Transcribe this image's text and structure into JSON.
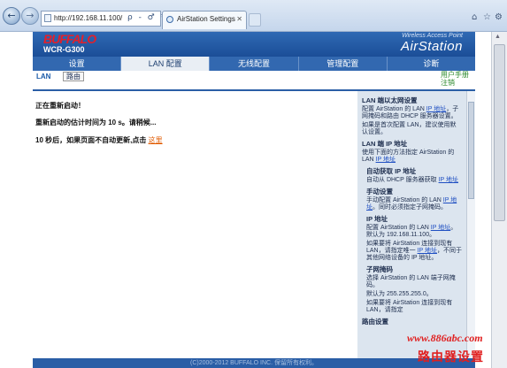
{
  "browser": {
    "url": "http://192.168.11.100/",
    "url_tools": "ρ - ♂ ↻ ✕",
    "tab_title": "AirStation Settings",
    "back_icon": "arrow-left-icon",
    "forward_icon": "arrow-right-icon"
  },
  "header": {
    "brand": "BUFFALO",
    "model": "WCR-G300",
    "tagline": "Wireless Access Point",
    "product": "AirStation"
  },
  "menu": {
    "items": [
      {
        "label": "设置",
        "active": false
      },
      {
        "label": "LAN 配置",
        "active": true
      },
      {
        "label": "无线配置",
        "active": false
      },
      {
        "label": "管理配置",
        "active": false
      },
      {
        "label": "诊断",
        "active": false
      }
    ]
  },
  "subnav": {
    "lan": "LAN",
    "route": "路由",
    "manual": "用户手册",
    "logout": "注销"
  },
  "main": {
    "line1": "正在重新启动！",
    "line2": "重新启动的估计时间为  10 s。请稍候...",
    "line3": "10 秒后，如果页面不自动更新,点击",
    "here_link": "这里"
  },
  "help": {
    "s1_title": "LAN 端以太网设置",
    "s1_p1a": "配置 AirStation 的 LAN",
    "s1_p1_link": "IP 地址",
    "s1_p1b": "，子网掩码和路由 DHCP 服务器设置。",
    "s1_p2": "如果是首次配置 LAN，建议使用默认设置。",
    "s2_title": "LAN 端 IP 地址",
    "s2_p1a": "使用下面的方法指定 AirStation 的 LAN",
    "s2_p1_link": "IP 地址",
    "s3_title": "自动获取 IP 地址",
    "s3_p1a": "自动从 DHCP 服务器获取",
    "s3_p1_link": "IP 地址",
    "s4_title": "手动设置",
    "s4_p1a": "手动配置 AirStation 的 LAN",
    "s4_p1_link": "IP 地址",
    "s4_p1b": "。同时必须指定子网掩码。",
    "s5_title": "IP 地址",
    "s5_p1a": "配置 AirStation 的 LAN",
    "s5_p1_link": "IP 地址",
    "s5_p1b": "。默认为 192.168.11.100。",
    "s5_p2a": "如果要将 AirStation 连接到现有 LAN，请指定唯一",
    "s5_p2_link": "IP 地址",
    "s5_p2b": "，不同于其他网络设备的 IP 地址。",
    "s6_title": "子网掩码",
    "s6_p1": "选择 AirStation 的 LAN 端子网掩码。",
    "s6_p2": "默认为 255.255.255.0。",
    "s6_p3": "如果要将 AirStation 连接到现有 LAN，请指定",
    "s7_title": "路由设置"
  },
  "footer": {
    "copyright": "(C)2000-2012 BUFFALO INC. 保留所有权利。"
  },
  "watermark": {
    "url": "www.886abc.com",
    "text": "路由器设置"
  },
  "colors": {
    "header_blue": "#2a5ea6",
    "logo_red": "#e3202a",
    "link_orange": "#e05a00",
    "help_bg": "#dce5ef",
    "watermark_red": "#e02020"
  }
}
